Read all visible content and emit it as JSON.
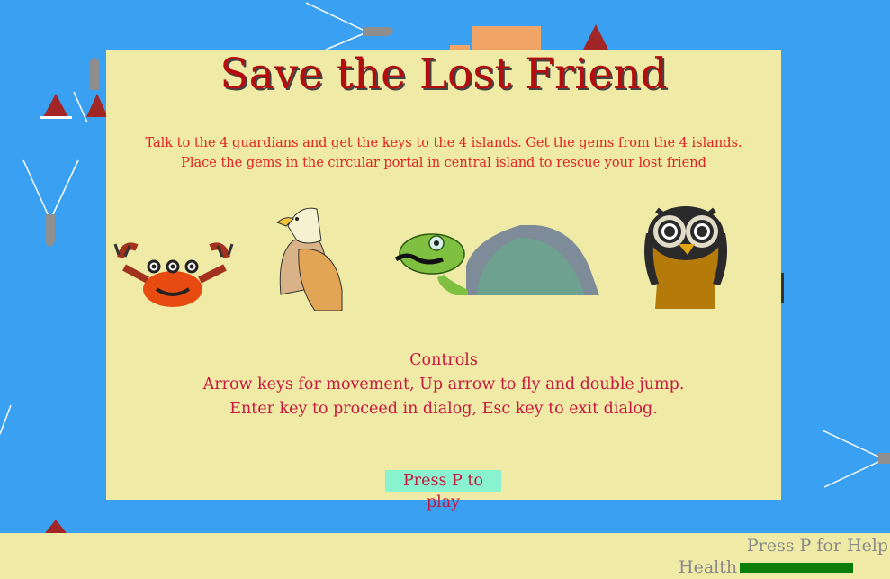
{
  "dialog": {
    "title": "Save the Lost Friend",
    "instructions": [
      "Talk to the 4 guardians and get the keys to the 4 islands. Get the gems from the 4 islands.",
      "Place the gems in the circular portal in central island to rescue your lost friend"
    ],
    "controls": {
      "heading": "Controls",
      "lines": [
        "Arrow keys for movement, Up arrow to fly and double jump.",
        "Enter key to proceed in dialog, Esc key to exit dialog."
      ]
    },
    "play_button": "Press P to play"
  },
  "guardians": [
    {
      "name": "crab-icon"
    },
    {
      "name": "eagle-icon"
    },
    {
      "name": "turtle-icon"
    },
    {
      "name": "owl-icon"
    }
  ],
  "hud": {
    "help_hint": "Press P for Help",
    "health_label": "Health",
    "health_fraction": 1.0
  },
  "colors": {
    "sky": "#3aa0f2",
    "panel": "#efeaa6",
    "title": "#b50d0d",
    "text": "#e32121",
    "controls_text": "#c7183f",
    "play_button_bg": "#89f2cf",
    "health": "#0a7d0a"
  }
}
